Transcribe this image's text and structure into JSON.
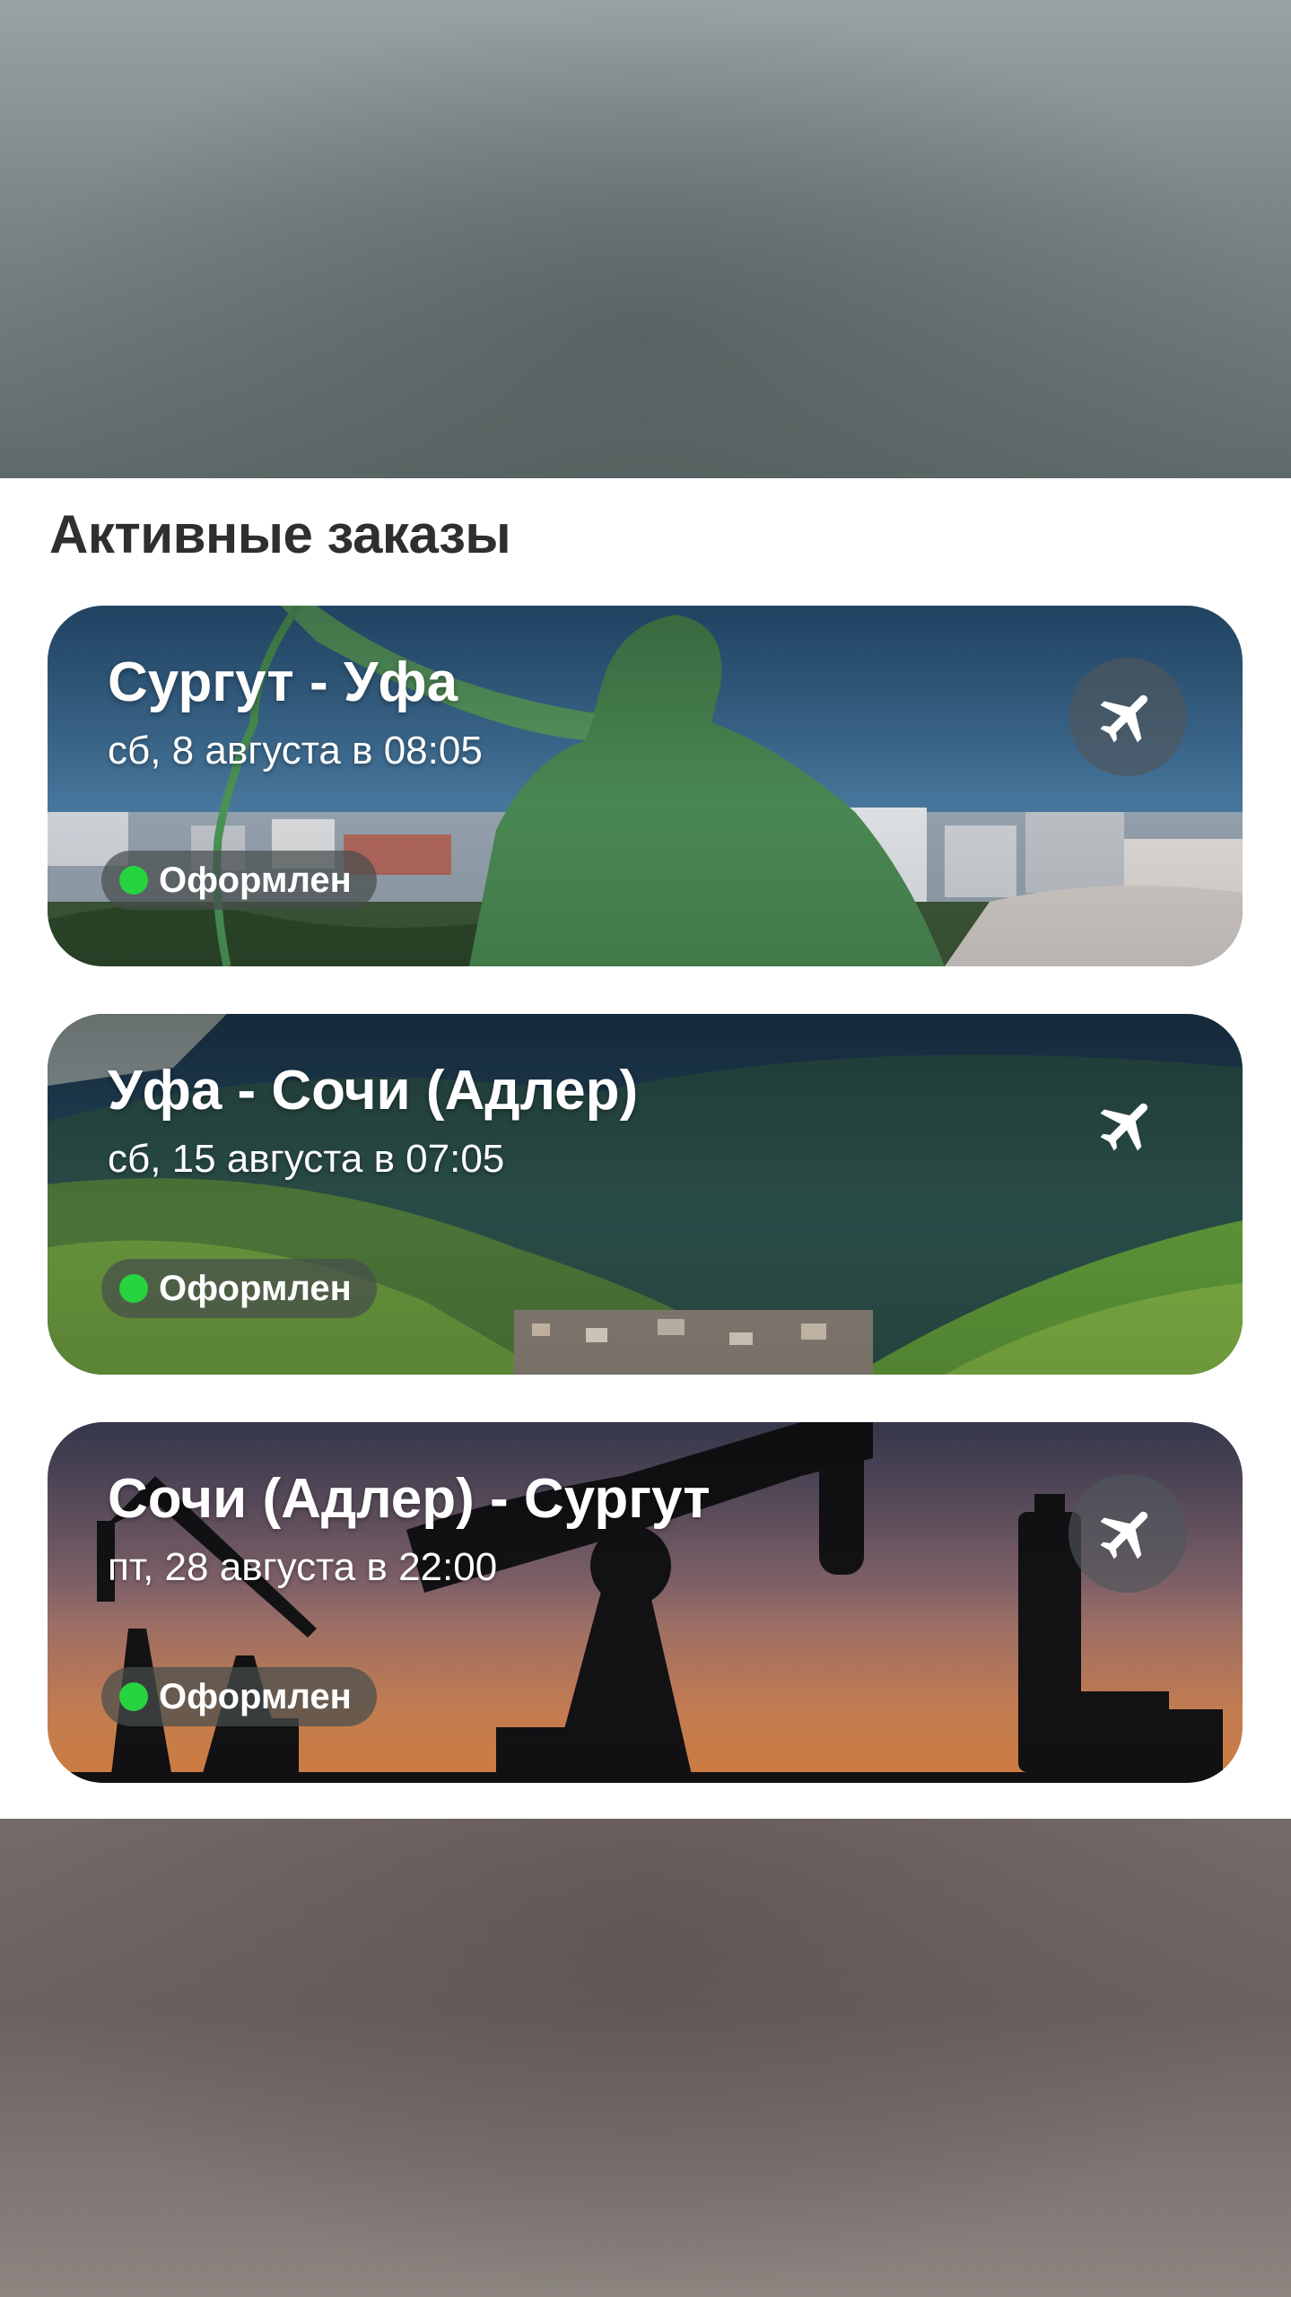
{
  "section": {
    "title": "Активные заказы"
  },
  "colors": {
    "status_dot": "#27d33f"
  },
  "orders": [
    {
      "route": "Сургут - Уфа",
      "date": "сб, 8 августа в 08:05",
      "status": "Оформлен",
      "icon": "airplane-icon"
    },
    {
      "route": "Уфа - Сочи (Адлер)",
      "date": "сб, 15 августа в 07:05",
      "status": "Оформлен",
      "icon": "airplane-icon"
    },
    {
      "route": "Сочи (Адлер) - Сургут",
      "date": "пт, 28 августа в 22:00",
      "status": "Оформлен",
      "icon": "airplane-icon"
    }
  ]
}
